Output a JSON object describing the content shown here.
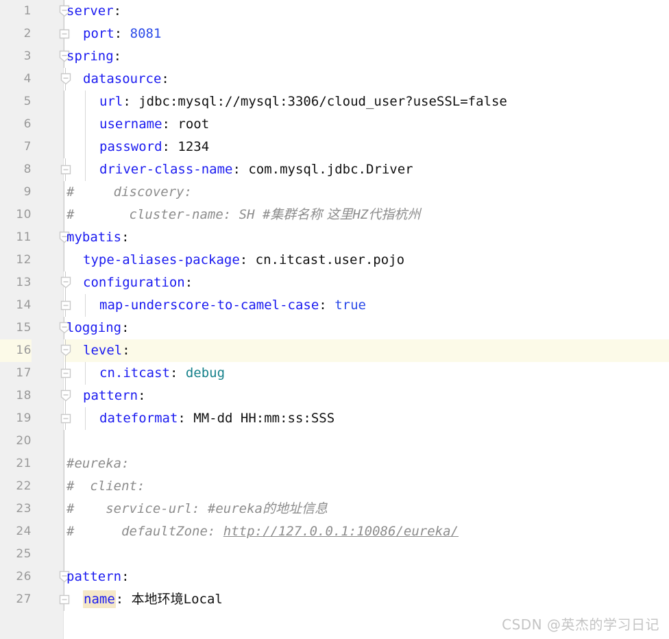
{
  "editor": {
    "language": "yaml",
    "file_kind": "application.yml",
    "caret_line": 16,
    "total_lines": 27,
    "colors": {
      "gutter_bg": "#f0f0f0",
      "editor_bg": "#ffffff",
      "line_number": "#999999",
      "key": "#1a1af0",
      "value": "#101010",
      "number": "#2a4ae8",
      "enum_value": "#14808a",
      "comment": "#8c8c8c",
      "caret_line_bg": "#fcfae8",
      "identifier_highlight_bg": "#f5e8c8",
      "fold_marker": "#c9c9c9",
      "watermark": "#c4c4c4"
    },
    "lines": [
      {
        "n": "1",
        "fold": "collapse-root",
        "indent": 0,
        "guides": [],
        "tokens": [
          {
            "t": "server",
            "c": "k"
          },
          {
            "t": ":",
            "c": "v"
          }
        ]
      },
      {
        "n": "2",
        "fold": "end-root",
        "indent": 1,
        "guides": [],
        "tokens": [
          {
            "t": "port",
            "c": "k"
          },
          {
            "t": ": ",
            "c": "v"
          },
          {
            "t": "8081",
            "c": "num"
          }
        ]
      },
      {
        "n": "3",
        "fold": "collapse-root",
        "indent": 0,
        "guides": [],
        "tokens": [
          {
            "t": "spring",
            "c": "k"
          },
          {
            "t": ":",
            "c": "v"
          }
        ]
      },
      {
        "n": "4",
        "fold": "collapse-nest",
        "indent": 1,
        "guides": [],
        "tokens": [
          {
            "t": "datasource",
            "c": "k"
          },
          {
            "t": ":",
            "c": "v"
          }
        ]
      },
      {
        "n": "5",
        "fold": "none",
        "indent": 2,
        "guides": [
          124
        ],
        "tokens": [
          {
            "t": "url",
            "c": "k"
          },
          {
            "t": ": ",
            "c": "v"
          },
          {
            "t": "jdbc:mysql://mysql:3306/cloud_user?useSSL=false",
            "c": "v"
          }
        ]
      },
      {
        "n": "6",
        "fold": "none",
        "indent": 2,
        "guides": [
          124
        ],
        "tokens": [
          {
            "t": "username",
            "c": "k"
          },
          {
            "t": ": ",
            "c": "v"
          },
          {
            "t": "root",
            "c": "v"
          }
        ]
      },
      {
        "n": "7",
        "fold": "none",
        "indent": 2,
        "guides": [
          124
        ],
        "tokens": [
          {
            "t": "password",
            "c": "k"
          },
          {
            "t": ": ",
            "c": "v"
          },
          {
            "t": "1234",
            "c": "v"
          }
        ]
      },
      {
        "n": "8",
        "fold": "end-nest",
        "indent": 2,
        "guides": [
          124
        ],
        "tokens": [
          {
            "t": "driver-class-name",
            "c": "k"
          },
          {
            "t": ": ",
            "c": "v"
          },
          {
            "t": "com.mysql.jdbc.Driver",
            "c": "v"
          }
        ]
      },
      {
        "n": "9",
        "fold": "none",
        "indent": 0,
        "guides": [],
        "tokens": [
          {
            "t": "#     discovery:",
            "c": "cm"
          }
        ]
      },
      {
        "n": "10",
        "fold": "none",
        "indent": 0,
        "guides": [],
        "tokens": [
          {
            "t": "#       cluster-name: SH #",
            "c": "cm"
          },
          {
            "t": "集群名称 这里",
            "c": "cm cjk"
          },
          {
            "t": "HZ",
            "c": "cm"
          },
          {
            "t": "代指杭州",
            "c": "cm cjk"
          }
        ]
      },
      {
        "n": "11",
        "fold": "collapse-root",
        "indent": 0,
        "guides": [],
        "tokens": [
          {
            "t": "mybatis",
            "c": "k"
          },
          {
            "t": ":",
            "c": "v"
          }
        ]
      },
      {
        "n": "12",
        "fold": "none",
        "indent": 1,
        "guides": [],
        "tokens": [
          {
            "t": "type-aliases-package",
            "c": "k"
          },
          {
            "t": ": ",
            "c": "v"
          },
          {
            "t": "cn.itcast.user.pojo",
            "c": "v"
          }
        ]
      },
      {
        "n": "13",
        "fold": "collapse-nest",
        "indent": 1,
        "guides": [],
        "tokens": [
          {
            "t": "configuration",
            "c": "k"
          },
          {
            "t": ":",
            "c": "v"
          }
        ]
      },
      {
        "n": "14",
        "fold": "end-nest",
        "indent": 2,
        "guides": [
          124
        ],
        "tokens": [
          {
            "t": "map-underscore-to-camel-case",
            "c": "k"
          },
          {
            "t": ": ",
            "c": "v"
          },
          {
            "t": "true",
            "c": "num"
          }
        ]
      },
      {
        "n": "15",
        "fold": "collapse-root",
        "indent": 0,
        "guides": [],
        "tokens": [
          {
            "t": "logging",
            "c": "k"
          },
          {
            "t": ":",
            "c": "v"
          }
        ]
      },
      {
        "n": "16",
        "fold": "collapse-nest",
        "indent": 1,
        "guides": [],
        "tokens": [
          {
            "t": "level",
            "c": "k"
          },
          {
            "t": ":",
            "c": "v"
          }
        ]
      },
      {
        "n": "17",
        "fold": "end-nest",
        "indent": 2,
        "guides": [
          124
        ],
        "tokens": [
          {
            "t": "cn.itcast",
            "c": "k"
          },
          {
            "t": ": ",
            "c": "v"
          },
          {
            "t": "debug",
            "c": "teal"
          }
        ]
      },
      {
        "n": "18",
        "fold": "collapse-nest",
        "indent": 1,
        "guides": [],
        "tokens": [
          {
            "t": "pattern",
            "c": "k"
          },
          {
            "t": ":",
            "c": "v"
          }
        ]
      },
      {
        "n": "19",
        "fold": "end-nest",
        "indent": 2,
        "guides": [
          124
        ],
        "tokens": [
          {
            "t": "dateformat",
            "c": "k"
          },
          {
            "t": ": ",
            "c": "v"
          },
          {
            "t": "MM-dd HH:mm:ss:SSS",
            "c": "v"
          }
        ]
      },
      {
        "n": "20",
        "fold": "none",
        "indent": 0,
        "guides": [],
        "tokens": []
      },
      {
        "n": "21",
        "fold": "none",
        "indent": 0,
        "guides": [],
        "tokens": [
          {
            "t": "#eureka:",
            "c": "cm"
          }
        ]
      },
      {
        "n": "22",
        "fold": "none",
        "indent": 0,
        "guides": [],
        "tokens": [
          {
            "t": "#  client:",
            "c": "cm"
          }
        ]
      },
      {
        "n": "23",
        "fold": "none",
        "indent": 0,
        "guides": [],
        "tokens": [
          {
            "t": "#    service-url: #eureka",
            "c": "cm"
          },
          {
            "t": "的地址信息",
            "c": "cm cjk"
          }
        ]
      },
      {
        "n": "24",
        "fold": "none",
        "indent": 0,
        "guides": [],
        "tokens": [
          {
            "t": "#      defaultZone: ",
            "c": "cm"
          },
          {
            "t": "http://127.0.0.1:10086/eureka/",
            "c": "cm",
            "u": true
          }
        ]
      },
      {
        "n": "25",
        "fold": "none",
        "indent": 0,
        "guides": [],
        "tokens": []
      },
      {
        "n": "26",
        "fold": "collapse-root",
        "indent": 0,
        "guides": [],
        "tokens": [
          {
            "t": "pattern",
            "c": "k"
          },
          {
            "t": ":",
            "c": "v"
          }
        ]
      },
      {
        "n": "27",
        "fold": "end-root",
        "indent": 1,
        "guides": [],
        "tokens": [
          {
            "t": "name",
            "c": "k",
            "hl": true
          },
          {
            "t": ": ",
            "c": "v"
          },
          {
            "t": "本地环境",
            "c": "v cjk"
          },
          {
            "t": "Local",
            "c": "v"
          }
        ]
      }
    ]
  },
  "watermark": {
    "text": "CSDN @英杰的学习日记"
  }
}
